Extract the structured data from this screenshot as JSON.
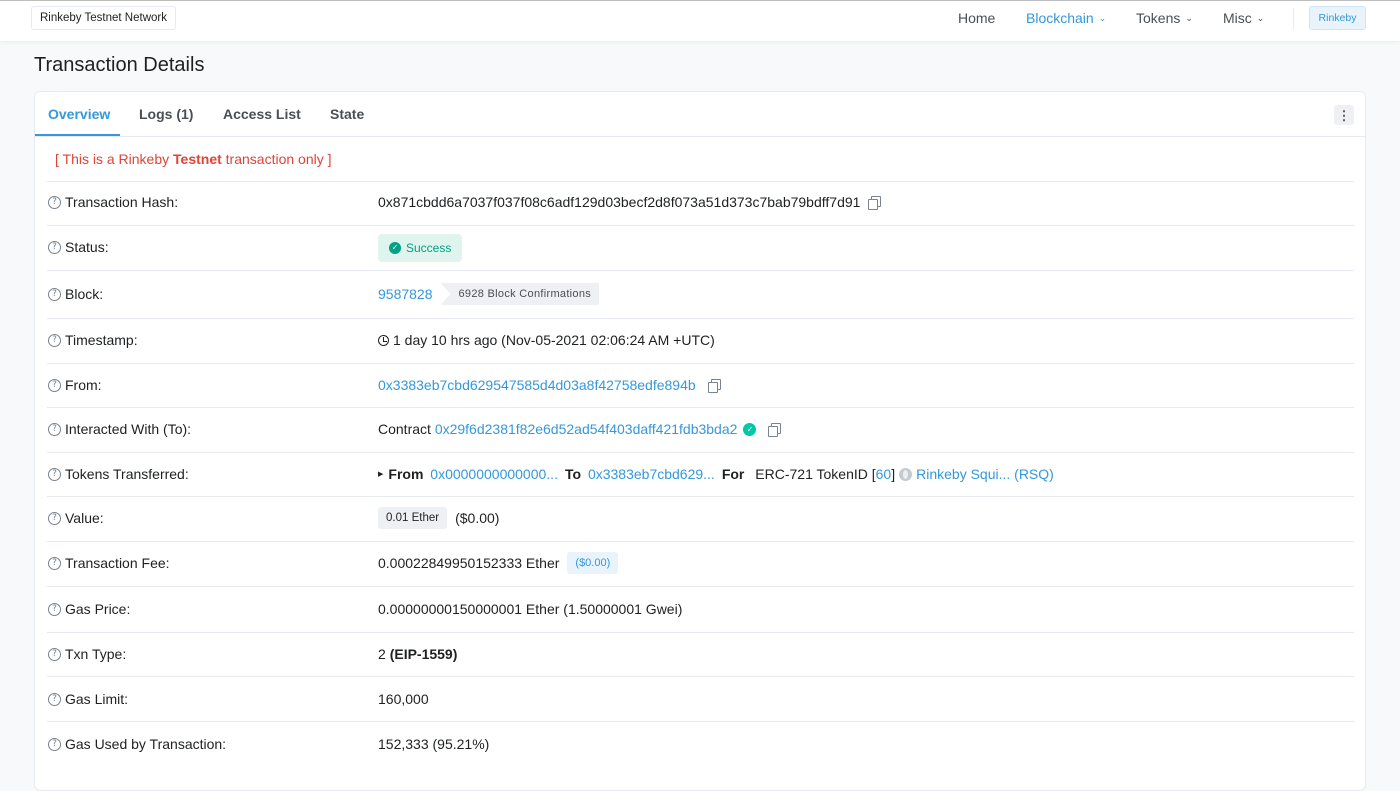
{
  "topbar": {
    "network": "Rinkeby Testnet Network",
    "nav": {
      "home": "Home",
      "blockchain": "Blockchain",
      "tokens": "Tokens",
      "misc": "Misc"
    },
    "network_button": "Rinkeby"
  },
  "page": {
    "title": "Transaction Details"
  },
  "tabs": {
    "overview": "Overview",
    "logs": "Logs (1)",
    "access_list": "Access List",
    "state": "State"
  },
  "notice": {
    "prefix": "[ This is a Rinkeby ",
    "emph": "Testnet",
    "suffix": " transaction only ]"
  },
  "rows": {
    "hash": {
      "label": "Transaction Hash:",
      "value": "0x871cbdd6a7037f037f08c6adf129d03becf2d8f073a51d373c7bab79bdff7d91"
    },
    "status": {
      "label": "Status:",
      "value": "Success"
    },
    "block": {
      "label": "Block:",
      "number": "9587828",
      "confirmations": "6928 Block Confirmations"
    },
    "timestamp": {
      "label": "Timestamp:",
      "value": "1 day 10 hrs ago (Nov-05-2021 02:06:24 AM +UTC)"
    },
    "from": {
      "label": "From:",
      "value": "0x3383eb7cbd629547585d4d03a8f42758edfe894b"
    },
    "to": {
      "label": "Interacted With (To):",
      "prefix": "Contract",
      "value": "0x29f6d2381f82e6d52ad54f403daff421fdb3bda2"
    },
    "tokens": {
      "label": "Tokens Transferred:",
      "from_label": "From",
      "from_value": "0x0000000000000...",
      "to_label": "To",
      "to_value": "0x3383eb7cbd629...",
      "for_label": "For",
      "token_type": "ERC-721 TokenID [",
      "token_id": "60",
      "token_close": "]",
      "token_name": "Rinkeby Squi... (RSQ)"
    },
    "value": {
      "label": "Value:",
      "amount": "0.01 Ether",
      "usd": "($0.00)"
    },
    "fee": {
      "label": "Transaction Fee:",
      "amount": "0.00022849950152333 Ether",
      "usd": "($0.00)"
    },
    "gas_price": {
      "label": "Gas Price:",
      "value": "0.00000000150000001 Ether (1.50000001 Gwei)"
    },
    "txn_type": {
      "label": "Txn Type:",
      "num": "2",
      "type": "(EIP-1559)"
    },
    "gas_limit": {
      "label": "Gas Limit:",
      "value": "160,000"
    },
    "gas_used": {
      "label": "Gas Used by Transaction:",
      "value": "152,333 (95.21%)"
    }
  },
  "colors": {
    "accent": "#3498db",
    "success": "#00a186",
    "danger": "#de4437"
  }
}
